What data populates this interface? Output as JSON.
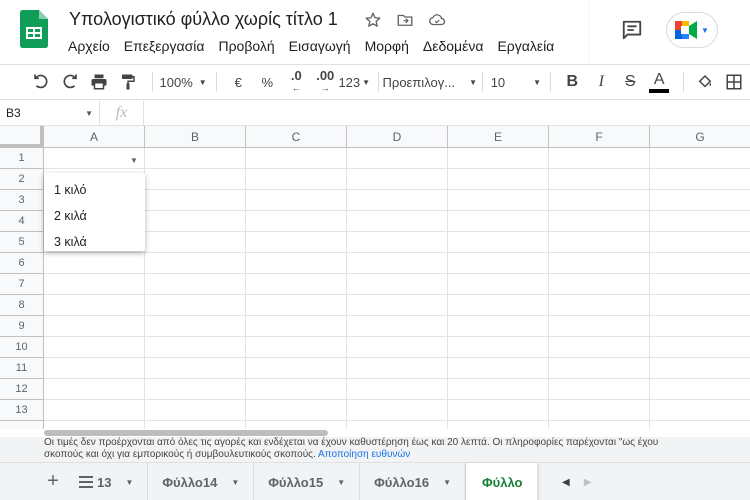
{
  "document": {
    "title": "Υπολογιστικό φύλλο χωρίς τίτλο 1"
  },
  "menu": [
    "Αρχείο",
    "Επεξεργασία",
    "Προβολή",
    "Εισαγωγή",
    "Μορφή",
    "Δεδομένα",
    "Εργαλεία"
  ],
  "toolbar": {
    "zoom": "100%",
    "currency": "€",
    "percent": "%",
    "decrease_decimals": ".0",
    "increase_decimals": ".00",
    "number_format": "123",
    "font": "Προεπιλογ...",
    "font_size": "10",
    "bold": "B",
    "italic": "I",
    "strikethrough": "S",
    "text_color": "A"
  },
  "formula_bar": {
    "name_box": "B3",
    "fx_label": "fx",
    "value": ""
  },
  "grid": {
    "columns": [
      "A",
      "B",
      "C",
      "D",
      "E",
      "F",
      "G"
    ],
    "rows": [
      "1",
      "2",
      "3",
      "4",
      "5",
      "6",
      "7",
      "8",
      "9",
      "10",
      "11",
      "12",
      "13"
    ]
  },
  "dropdown": {
    "options": [
      "1 κιλό",
      "2 κιλά",
      "3 κιλά"
    ]
  },
  "disclaimer": {
    "line1": "Οι τιμές δεν προέρχονται από όλες τις αγορές και ενδέχεται να έχουν καθυστέρηση έως και 20 λεπτά. Οι πληροφορίες παρέχονται \"ως έχου",
    "line2": "σκοπούς και όχι για εμπορικούς ή συμβουλευτικούς σκοπούς.",
    "link": "Αποποίηση ευθυνών"
  },
  "sheet_tabs": {
    "tabs": [
      "13",
      "Φύλλο14",
      "Φύλλο15",
      "Φύλλο16",
      "Φύλλο"
    ],
    "active_index": 4
  },
  "colors": {
    "brand_green": "#0f9d58",
    "active_tab_text": "#188038",
    "link_blue": "#1a73e8"
  }
}
